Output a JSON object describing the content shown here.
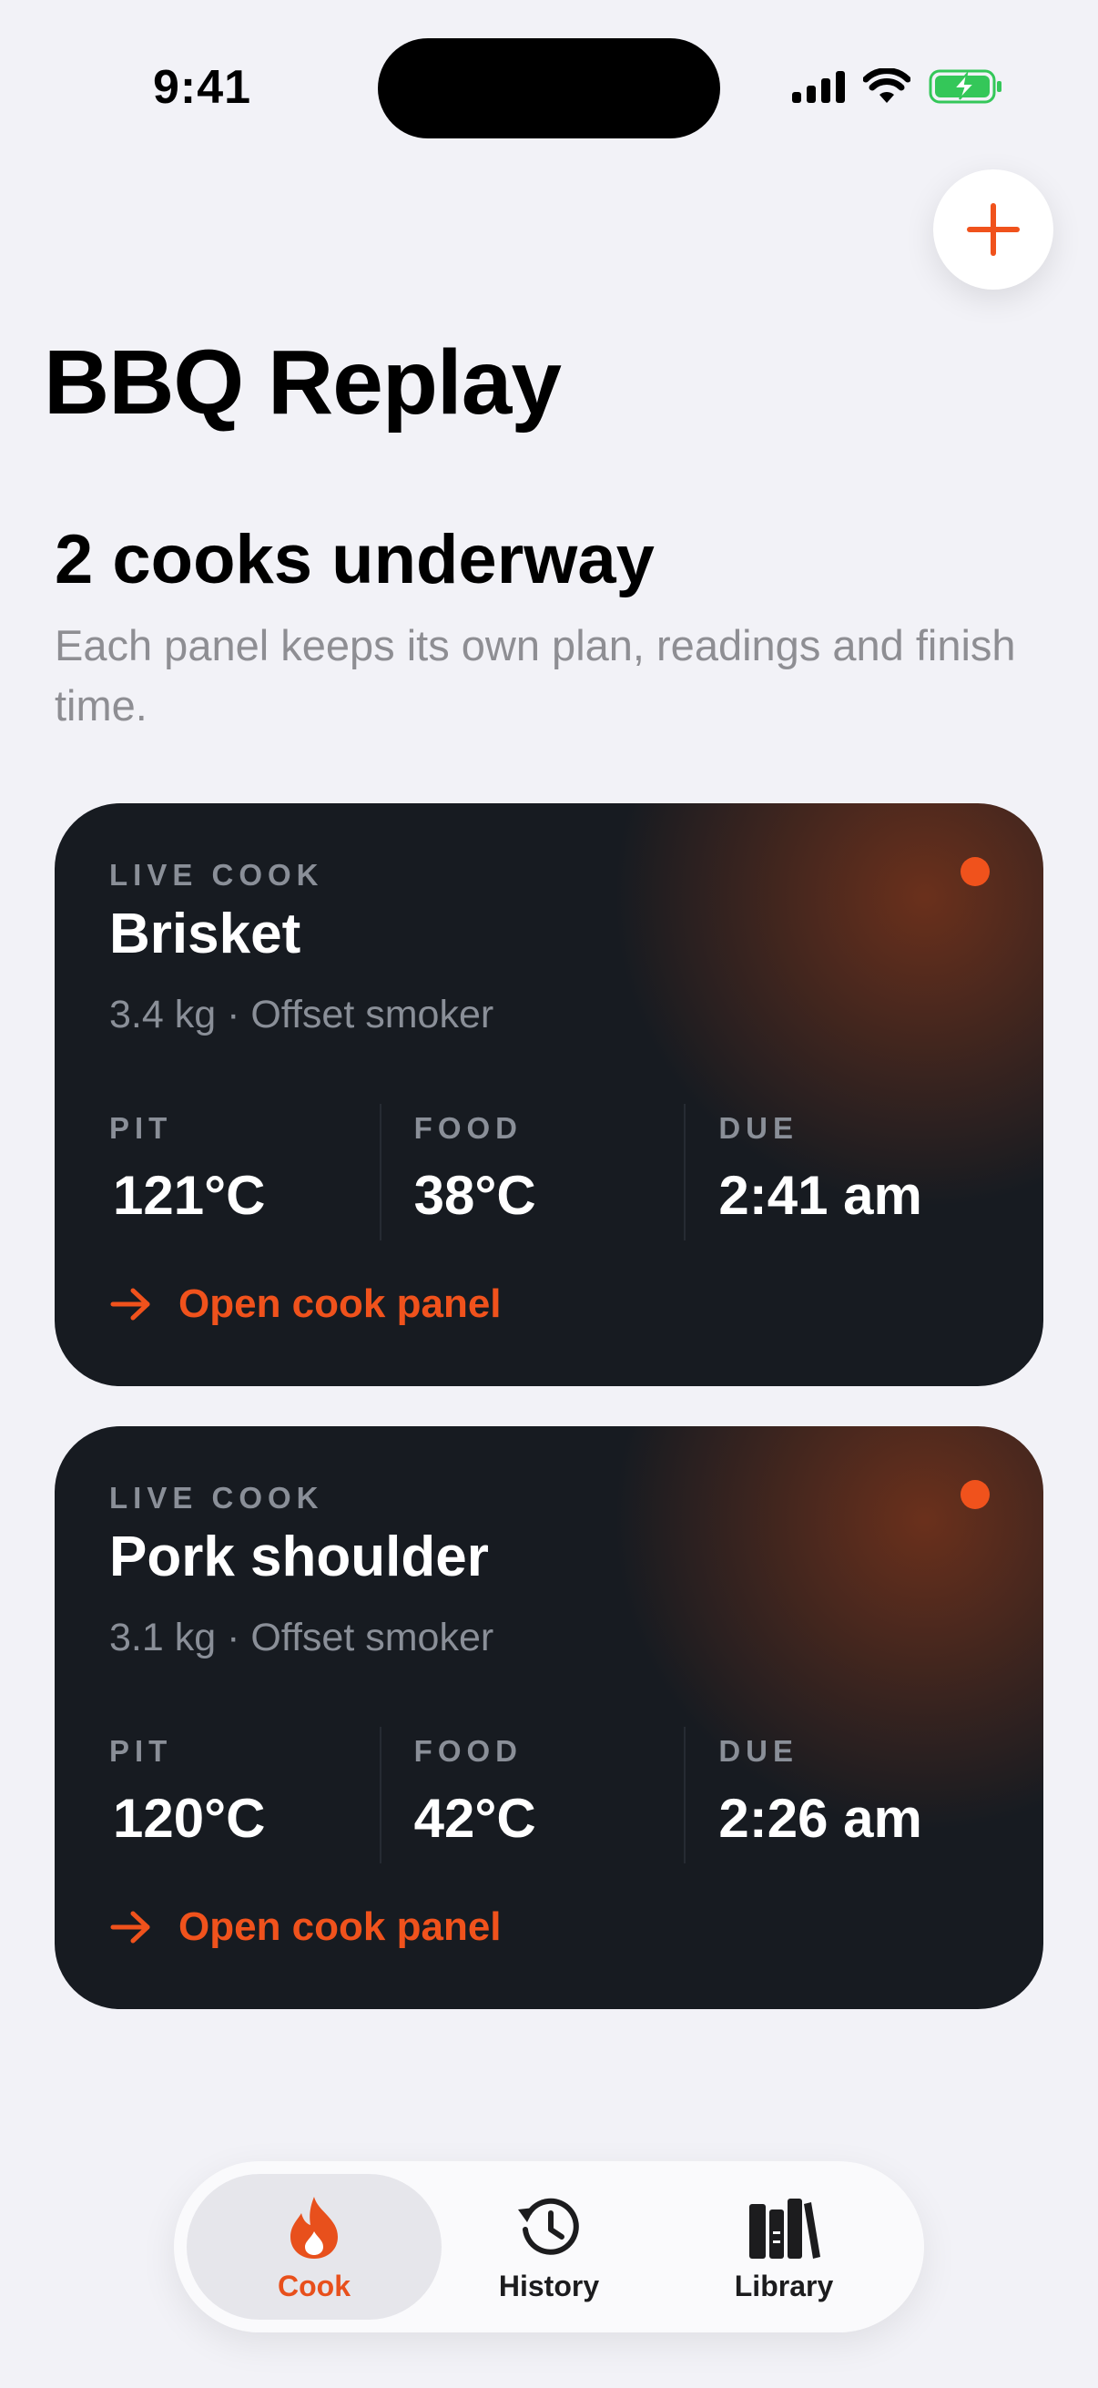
{
  "status_bar": {
    "time": "9:41"
  },
  "header": {
    "title": "BBQ Replay",
    "add_label": "+"
  },
  "section": {
    "title": "2 cooks underway",
    "subtitle": "Each panel keeps its own plan, readings and finish time."
  },
  "cooks": [
    {
      "eyebrow": "LIVE COOK",
      "name": "Brisket",
      "meta": "3.4 kg · Offset smoker",
      "stats": [
        {
          "label": "PIT",
          "value": "121°C"
        },
        {
          "label": "FOOD",
          "value": "38°C"
        },
        {
          "label": "DUE",
          "value": "2:41 am"
        }
      ],
      "action": "Open cook panel"
    },
    {
      "eyebrow": "LIVE COOK",
      "name": "Pork shoulder",
      "meta": "3.1 kg · Offset smoker",
      "stats": [
        {
          "label": "PIT",
          "value": "120°C"
        },
        {
          "label": "FOOD",
          "value": "42°C"
        },
        {
          "label": "DUE",
          "value": "2:26 am"
        }
      ],
      "action": "Open cook panel"
    }
  ],
  "tab_bar": {
    "tabs": [
      {
        "label": "Cook",
        "icon": "flame-icon",
        "active": true
      },
      {
        "label": "History",
        "icon": "history-clock-icon",
        "active": false
      },
      {
        "label": "Library",
        "icon": "books-icon",
        "active": false
      }
    ]
  },
  "colors": {
    "accent": "#F0521C",
    "card_background": "#171B21",
    "page_background": "#F2F2F7",
    "battery": "#34C759"
  }
}
